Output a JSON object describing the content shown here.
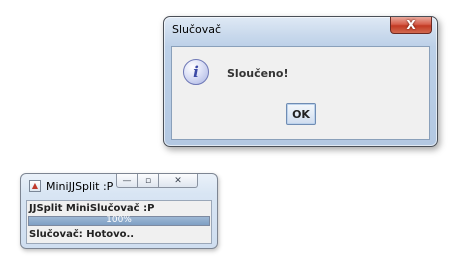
{
  "dialog": {
    "title": "Slučovač",
    "close_glyph": "X",
    "icon": "info-icon",
    "icon_glyph": "i",
    "message": "Sloučeno!",
    "ok_label": "OK"
  },
  "mini_window": {
    "title": "MiniJJSplit :P",
    "app_icon": "app-icon",
    "minimize_glyph": "—",
    "maximize_glyph": "▫",
    "close_glyph": "✕",
    "label": "JJSplit MiniSlučovač :P",
    "progress_percent": 100,
    "progress_text": "100%",
    "status": "Slučovač: Hotovo.."
  },
  "colors": {
    "close_button": "#c23a24",
    "progress_fill": "#8eabcc"
  }
}
